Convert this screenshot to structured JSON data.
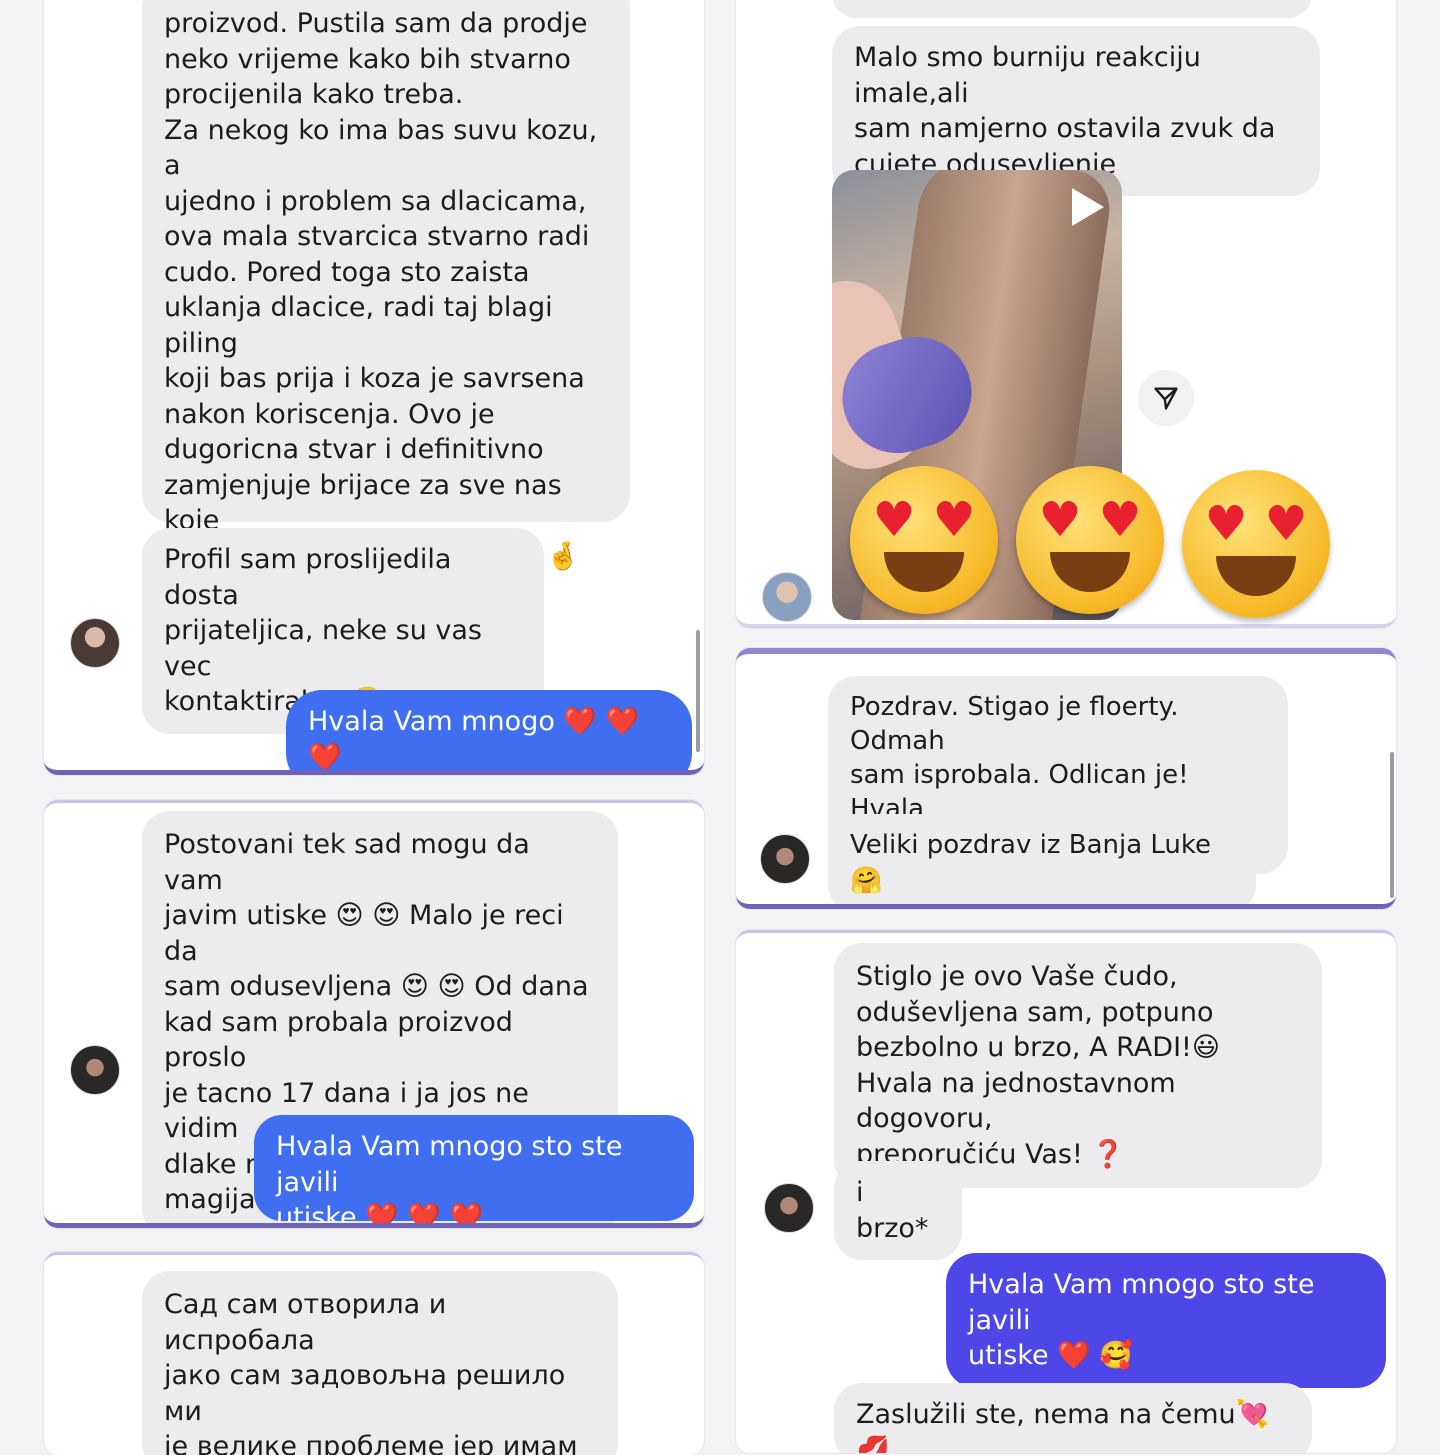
{
  "cards": {
    "c1": {
      "msg1": "proizvod. Pustila sam da prodje\nneko vrijeme kako bih stvarno\nprocijenila kako treba.\nZa nekog ko ima bas suvu kozu, a\nujedno i problem sa dlacicama,\nova mala stvarcica stvarno radi\ncudo. Pored toga sto zaista\nuklanja dlacice, radi taj blagi piling\nkoji bas prija i koza je savrsena\nnakon koriscenja. Ovo je\ndugoricna stvar i definitivno\nzamjenjuje brijace za sve nas koje\nnismo tako spretne sa istim 🤞 😅\nSjajno. Hvala💜",
      "msg2": "Profil sam proslijedila dosta\nprijateljica, neke su vas vec\nkontaktirale.. 🤗",
      "reply": "Hvala Vam mnogo ❤️ ❤️ ❤️"
    },
    "c2": {
      "msg1": "Malo smo burniju reakciju imale,ali\nsam namjerno ostavila zvuk da\ncujete odusevljenje"
    },
    "c3": {
      "msg1": "Postovani tek sad mogu da vam\njavim utiske 😍 😍 Malo je reci da\nsam odusevljena 😍 😍 Od dana\nkad sam probala proizvod proslo\nje tacno 17 dana i ja jos ne vidim\ndlake ni na vidiku znaci ovo je\nmagija 😍 😍",
      "reply": "Hvala Vam mnogo sto ste javili\nutiske ❤️ ❤️ ❤️"
    },
    "c4": {
      "msg1": "Pozdrav. Stigao je floerty. Odmah\nsam isprobala. Odlican je! Hvala\nvam punoo 🤗 🤗 🤗",
      "msg2": "Veliki pozdrav iz Banja Luke 🤗"
    },
    "c5": {
      "msg1": "Сад сам отворила и испробала\nјако сам задовољна решило ми\nје велике проблеме јер имам\nпроблем са кожом а ово је јако"
    },
    "c6": {
      "msg1": "Stiglo je ovo Vaše čudo,\noduševljena sam, potpuno\nbezbolno u brzo, A RADI!😃\nHvala na jednostavnom dogovoru,\npreporučiću Vas! ❓",
      "msg2": "i brzo*",
      "reply": "Hvala Vam mnogo sto ste javili\nutiske ❤️ 🥰",
      "msg3": "Zaslužili ste, nema na čemu💘 💋"
    }
  },
  "icons": {
    "play": "play-icon",
    "share": "send-icon",
    "reaction": "heart-eyes-emoji"
  },
  "colors": {
    "incoming_bubble": "#ececee",
    "outgoing_bubble": "#3f6ff0",
    "outgoing_violet": "#4d47e8",
    "card_accent": "#6d63b8"
  }
}
